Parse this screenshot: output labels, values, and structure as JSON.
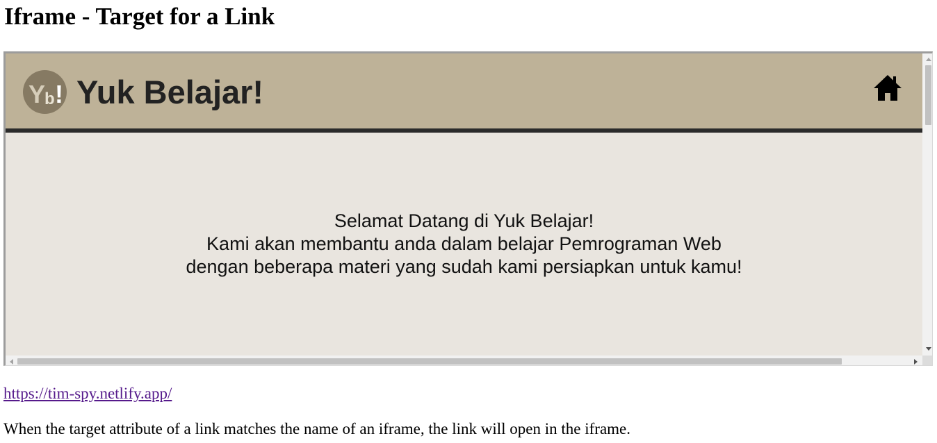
{
  "page": {
    "heading": "Iframe - Target for a Link",
    "link_text": "https://tim-spy.netlify.app/",
    "description": "When the target attribute of a link matches the name of an iframe, the link will open in the iframe."
  },
  "iframe": {
    "site_title": "Yuk Belajar!",
    "logo_text": "Yb!",
    "welcome_lines": [
      "Selamat Datang di Yuk Belajar!",
      "Kami akan membantu anda dalam belajar Pemrograman Web",
      "dengan beberapa materi yang sudah kami persiapkan untuk kamu!"
    ],
    "home_icon": "home-icon"
  },
  "colors": {
    "header_bg": "#beb298",
    "header_border": "#2b2b2b",
    "main_bg": "#e9e5df",
    "logo_circle": "#867a63",
    "link_visited": "#551a8b"
  }
}
